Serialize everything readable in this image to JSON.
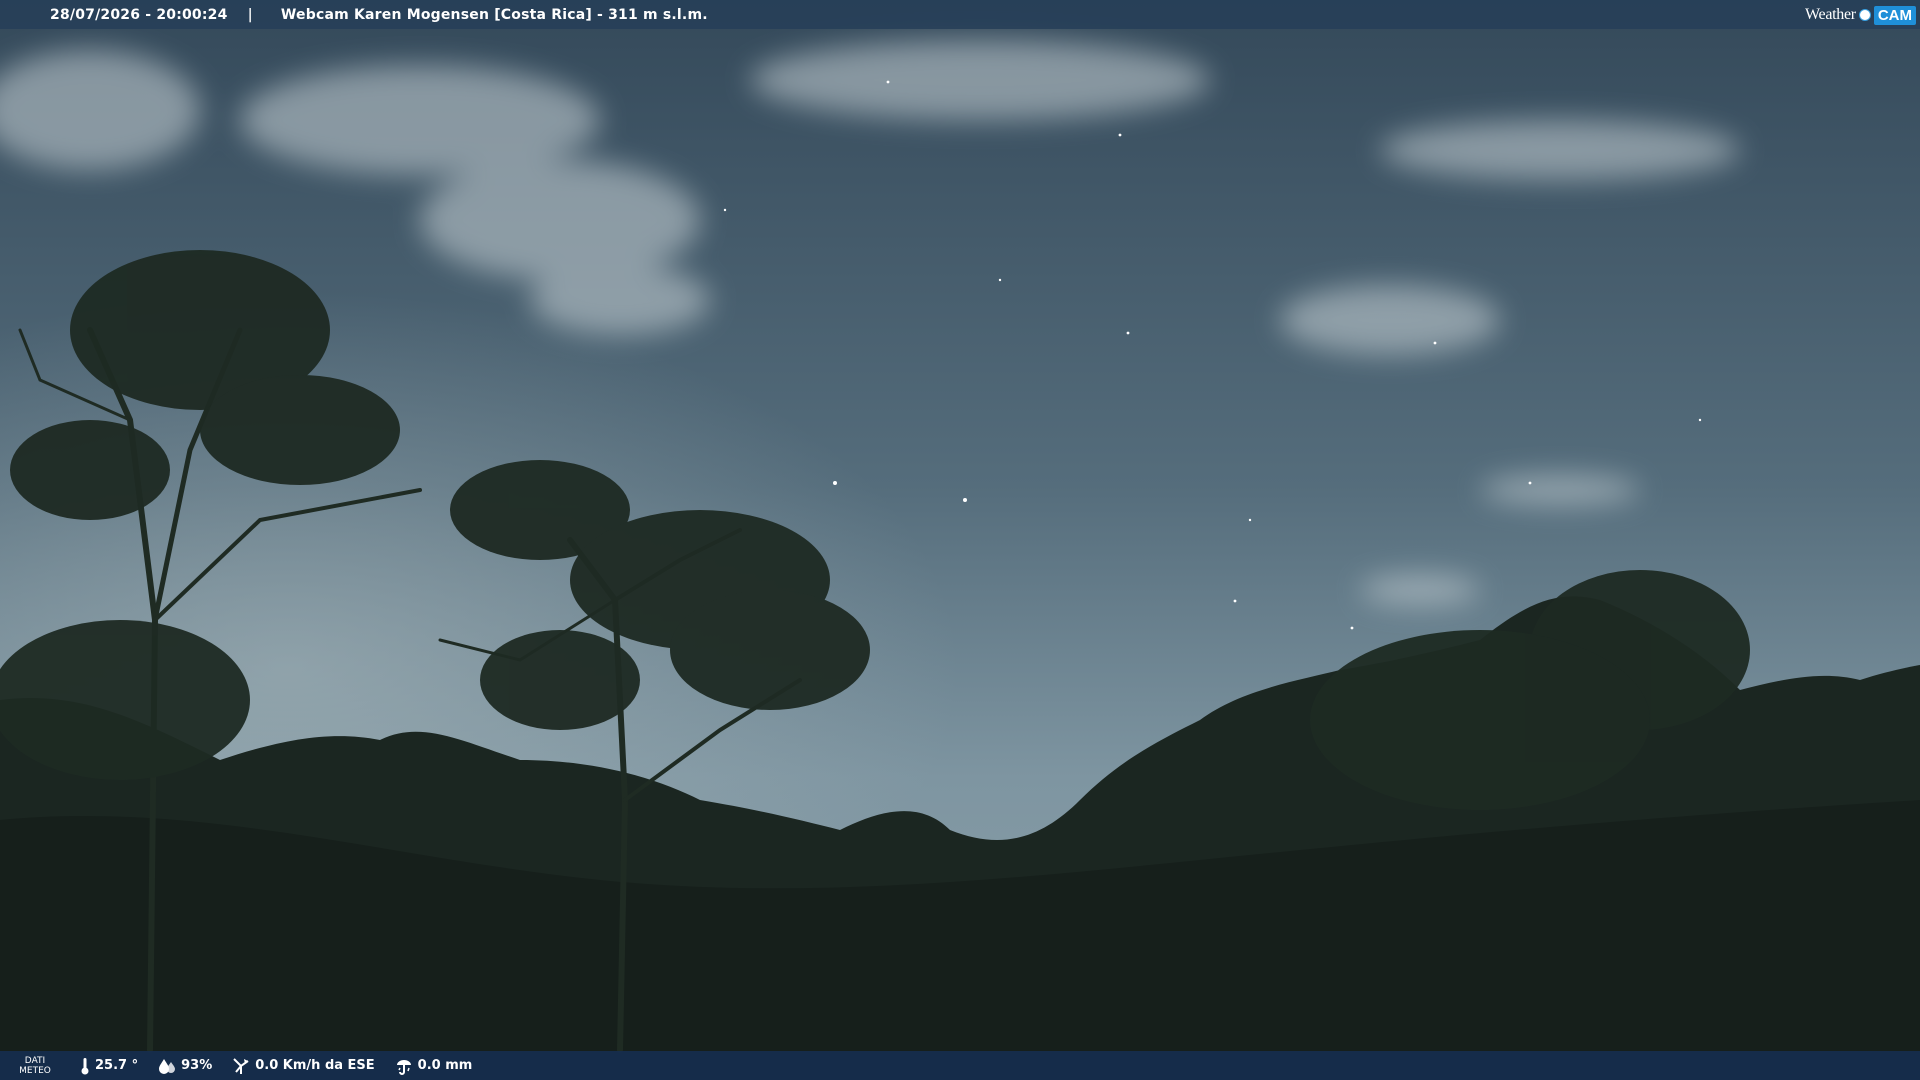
{
  "header": {
    "datetime": "28/07/2026 - 20:00:24",
    "separator": "|",
    "title": "Webcam Karen Mogensen [Costa Rica]  - 311 m s.l.m.",
    "brand_left": "Weather",
    "brand_right": "CAM"
  },
  "weather_bar": {
    "label_line1": "DATI",
    "label_line2": "METEO",
    "temperature": "25.7 °",
    "humidity": "93%",
    "wind": "0.0 Km/h da ESE",
    "rain": "0.0 mm"
  },
  "icons": {
    "temperature": "thermometer-icon",
    "humidity": "water-drop-icon",
    "wind": "wind-vane-icon",
    "rain": "rain-gauge-icon",
    "brand": "globe-dot-icon"
  },
  "colors": {
    "sky_top": "#3b4f5d",
    "sky_mid": "#5b7382",
    "sky_horizon": "#8fa3ad",
    "foliage": "#1a241f",
    "bar": "#263e58",
    "brand_cam": "#1f8fd8"
  }
}
